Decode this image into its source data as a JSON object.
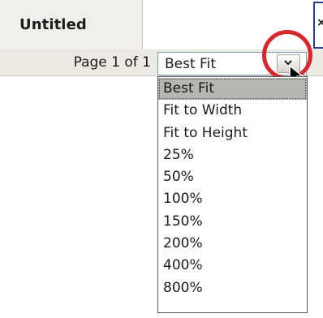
{
  "tab": {
    "title": "Untitled",
    "close_label": "×"
  },
  "toolbar": {
    "page_indicator": "Page 1 of 1"
  },
  "zoom": {
    "current_value": "Best Fit",
    "options": [
      "Best Fit",
      "Fit to Width",
      "Fit to Height",
      "25%",
      "50%",
      "100%",
      "150%",
      "200%",
      "400%",
      "800%"
    ],
    "selected_index": 0
  },
  "colors": {
    "highlight_ring": "#d8262a",
    "combo_border": "#7f9db9",
    "tab_accent": "#2b3f8f",
    "selected_item_bg": "#b7b5b1"
  },
  "icons": {
    "dropdown": "chevron-down-icon",
    "pointer": "mouse-pointer-icon",
    "close": "close-icon"
  }
}
